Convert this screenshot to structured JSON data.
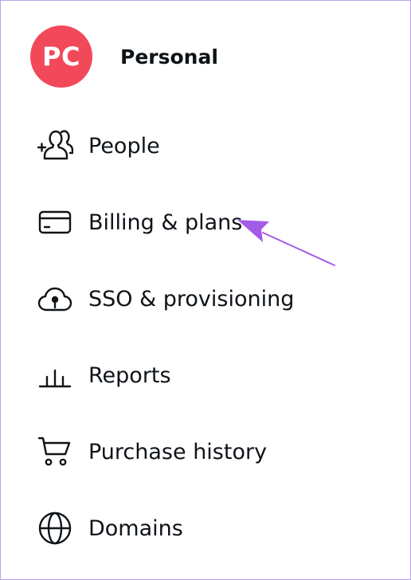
{
  "team": {
    "initials": "PC",
    "name": "Personal",
    "avatar_color": "#f2495a"
  },
  "menu": {
    "items": [
      {
        "label": "People",
        "icon": "add-people-icon"
      },
      {
        "label": "Billing & plans",
        "icon": "credit-card-icon"
      },
      {
        "label": "SSO & provisioning",
        "icon": "cloud-lock-icon"
      },
      {
        "label": "Reports",
        "icon": "bar-chart-icon"
      },
      {
        "label": "Purchase history",
        "icon": "shopping-cart-icon"
      },
      {
        "label": "Domains",
        "icon": "globe-icon"
      }
    ]
  },
  "annotation": {
    "arrow_color": "#a45be8",
    "points_to": "Billing & plans"
  },
  "colors": {
    "frame_border": "#b9a2e6",
    "text": "#0e1318"
  }
}
